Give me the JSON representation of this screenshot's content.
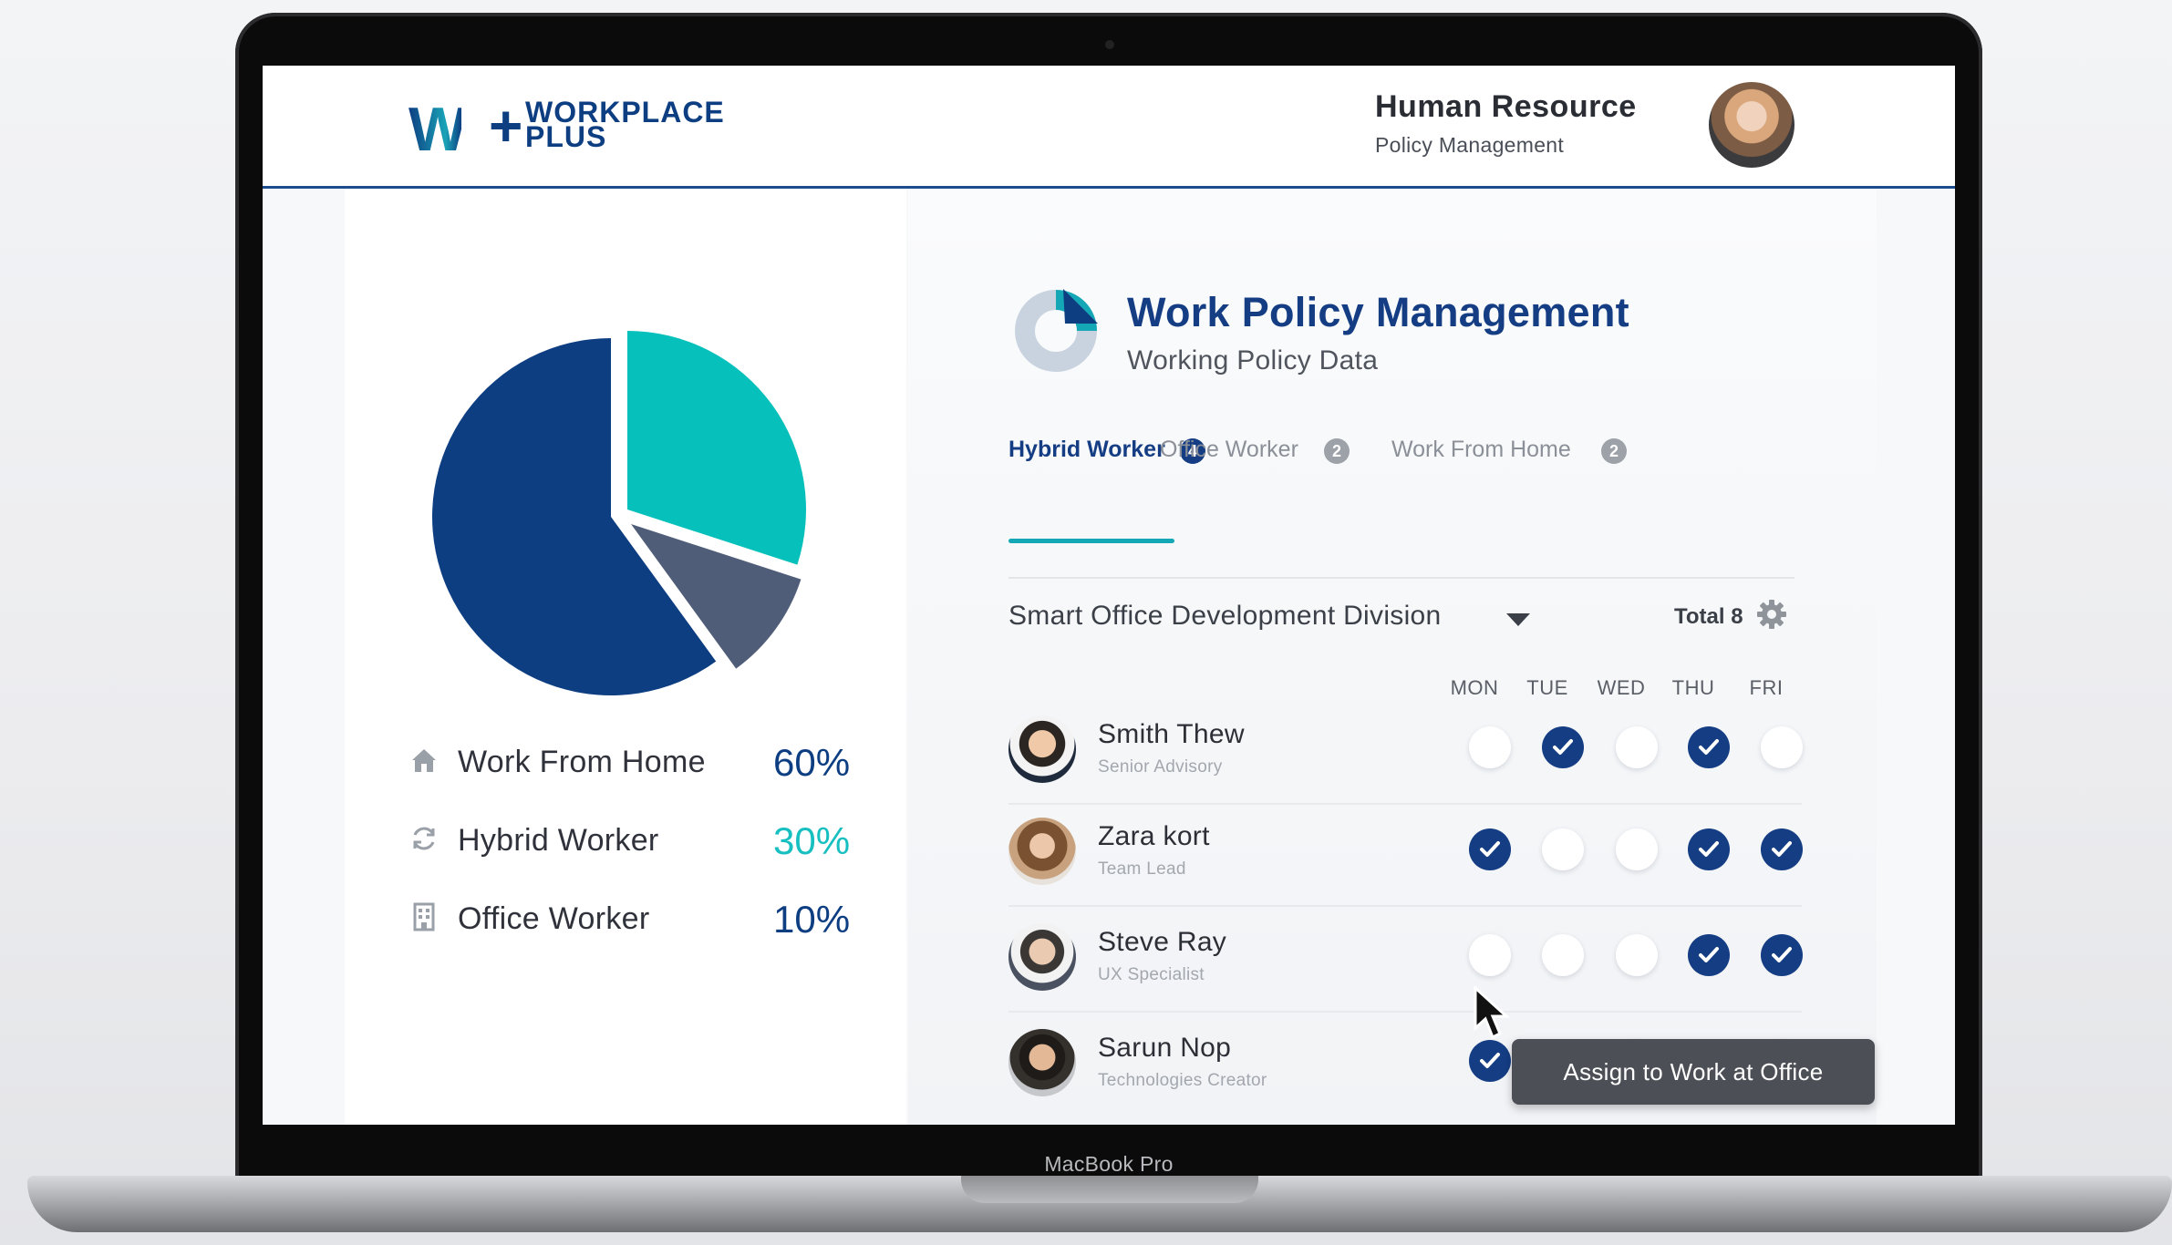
{
  "device": {
    "bezel_label": "MacBook Pro"
  },
  "header": {
    "logo_mark": "W",
    "logo_plus": "+",
    "logo_line1": "WORKPLACE",
    "logo_line2": "PLUS",
    "title": "Human Resource",
    "subtitle": "Policy Management"
  },
  "summary": {
    "legend": [
      {
        "label": "Work From Home",
        "value": "60%",
        "icon": "home-icon",
        "color": "#0d3e82"
      },
      {
        "label": "Hybrid Worker",
        "value": "30%",
        "icon": "sync-icon",
        "color": "#17bfc0"
      },
      {
        "label": "Office Worker",
        "value": "10%",
        "icon": "building-icon",
        "color": "#0d3e82"
      }
    ],
    "pie_colors": {
      "work_from_home": "#0d3e82",
      "hybrid_worker": "#05c0bb",
      "office_worker": "#4f5d78"
    }
  },
  "policy": {
    "title": "Work Policy Management",
    "subtitle": "Working Policy Data",
    "tabs": [
      {
        "label": "Hybrid Worker",
        "count": "4",
        "active": true
      },
      {
        "label": "Office Worker",
        "count": "2",
        "active": false
      },
      {
        "label": "Work From Home",
        "count": "2",
        "active": false
      }
    ],
    "division": "Smart Office Development Division",
    "total": "Total 8",
    "days": [
      "MON",
      "TUE",
      "WED",
      "THU",
      "FRI"
    ],
    "employees": [
      {
        "name": "Smith Thew",
        "role": "Senior Advisory",
        "schedule": [
          false,
          true,
          false,
          true,
          false
        ]
      },
      {
        "name": "Zara kort",
        "role": "Team Lead",
        "schedule": [
          true,
          false,
          false,
          true,
          true
        ]
      },
      {
        "name": "Steve Ray",
        "role": "UX Specialist",
        "schedule": [
          false,
          false,
          false,
          true,
          true
        ]
      },
      {
        "name": "Sarun Nop",
        "role": "Technologies Creator",
        "schedule": [
          true,
          true,
          false,
          true,
          false
        ]
      }
    ],
    "tooltip": "Assign to Work at Office"
  },
  "accent_colors": {
    "primary": "#143d84",
    "teal": "#14a7b6"
  }
}
